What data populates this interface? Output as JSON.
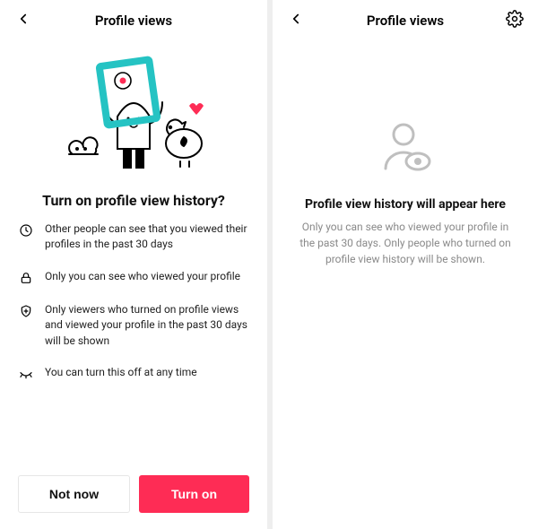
{
  "left": {
    "header_title": "Profile views",
    "question_title": "Turn on profile view history?",
    "features": [
      "Other people can see that you viewed their profiles in the past 30 days",
      "Only you can see who viewed your profile",
      "Only viewers who turned on profile views and viewed your profile in the past 30 days will be shown",
      "You can turn this off at any time"
    ],
    "buttons": {
      "secondary": "Not now",
      "primary": "Turn on"
    }
  },
  "right": {
    "header_title": "Profile views",
    "heading": "Profile view history will appear here",
    "description": "Only you can see who viewed your profile in the past 30 days. Only people who turned on profile view history will be shown."
  },
  "colors": {
    "accent": "#fe2c55",
    "frame": "#25c3c3"
  }
}
